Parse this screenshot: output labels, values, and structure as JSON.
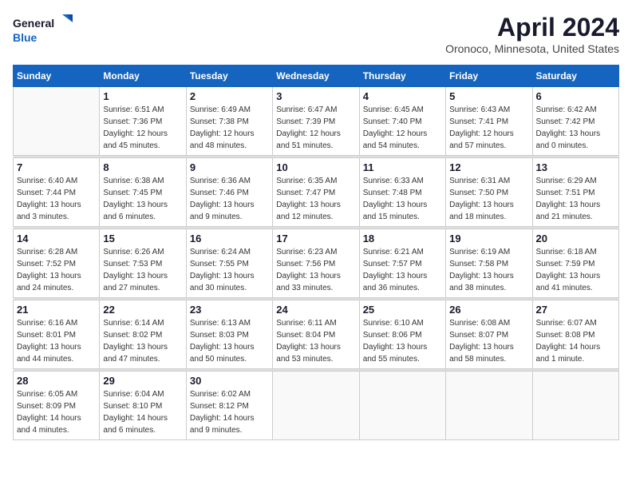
{
  "header": {
    "logo_line1": "General",
    "logo_line2": "Blue",
    "month_title": "April 2024",
    "subtitle": "Oronoco, Minnesota, United States"
  },
  "days_of_week": [
    "Sunday",
    "Monday",
    "Tuesday",
    "Wednesday",
    "Thursday",
    "Friday",
    "Saturday"
  ],
  "weeks": [
    [
      {
        "day": "",
        "info": ""
      },
      {
        "day": "1",
        "info": "Sunrise: 6:51 AM\nSunset: 7:36 PM\nDaylight: 12 hours\nand 45 minutes."
      },
      {
        "day": "2",
        "info": "Sunrise: 6:49 AM\nSunset: 7:38 PM\nDaylight: 12 hours\nand 48 minutes."
      },
      {
        "day": "3",
        "info": "Sunrise: 6:47 AM\nSunset: 7:39 PM\nDaylight: 12 hours\nand 51 minutes."
      },
      {
        "day": "4",
        "info": "Sunrise: 6:45 AM\nSunset: 7:40 PM\nDaylight: 12 hours\nand 54 minutes."
      },
      {
        "day": "5",
        "info": "Sunrise: 6:43 AM\nSunset: 7:41 PM\nDaylight: 12 hours\nand 57 minutes."
      },
      {
        "day": "6",
        "info": "Sunrise: 6:42 AM\nSunset: 7:42 PM\nDaylight: 13 hours\nand 0 minutes."
      }
    ],
    [
      {
        "day": "7",
        "info": "Sunrise: 6:40 AM\nSunset: 7:44 PM\nDaylight: 13 hours\nand 3 minutes."
      },
      {
        "day": "8",
        "info": "Sunrise: 6:38 AM\nSunset: 7:45 PM\nDaylight: 13 hours\nand 6 minutes."
      },
      {
        "day": "9",
        "info": "Sunrise: 6:36 AM\nSunset: 7:46 PM\nDaylight: 13 hours\nand 9 minutes."
      },
      {
        "day": "10",
        "info": "Sunrise: 6:35 AM\nSunset: 7:47 PM\nDaylight: 13 hours\nand 12 minutes."
      },
      {
        "day": "11",
        "info": "Sunrise: 6:33 AM\nSunset: 7:48 PM\nDaylight: 13 hours\nand 15 minutes."
      },
      {
        "day": "12",
        "info": "Sunrise: 6:31 AM\nSunset: 7:50 PM\nDaylight: 13 hours\nand 18 minutes."
      },
      {
        "day": "13",
        "info": "Sunrise: 6:29 AM\nSunset: 7:51 PM\nDaylight: 13 hours\nand 21 minutes."
      }
    ],
    [
      {
        "day": "14",
        "info": "Sunrise: 6:28 AM\nSunset: 7:52 PM\nDaylight: 13 hours\nand 24 minutes."
      },
      {
        "day": "15",
        "info": "Sunrise: 6:26 AM\nSunset: 7:53 PM\nDaylight: 13 hours\nand 27 minutes."
      },
      {
        "day": "16",
        "info": "Sunrise: 6:24 AM\nSunset: 7:55 PM\nDaylight: 13 hours\nand 30 minutes."
      },
      {
        "day": "17",
        "info": "Sunrise: 6:23 AM\nSunset: 7:56 PM\nDaylight: 13 hours\nand 33 minutes."
      },
      {
        "day": "18",
        "info": "Sunrise: 6:21 AM\nSunset: 7:57 PM\nDaylight: 13 hours\nand 36 minutes."
      },
      {
        "day": "19",
        "info": "Sunrise: 6:19 AM\nSunset: 7:58 PM\nDaylight: 13 hours\nand 38 minutes."
      },
      {
        "day": "20",
        "info": "Sunrise: 6:18 AM\nSunset: 7:59 PM\nDaylight: 13 hours\nand 41 minutes."
      }
    ],
    [
      {
        "day": "21",
        "info": "Sunrise: 6:16 AM\nSunset: 8:01 PM\nDaylight: 13 hours\nand 44 minutes."
      },
      {
        "day": "22",
        "info": "Sunrise: 6:14 AM\nSunset: 8:02 PM\nDaylight: 13 hours\nand 47 minutes."
      },
      {
        "day": "23",
        "info": "Sunrise: 6:13 AM\nSunset: 8:03 PM\nDaylight: 13 hours\nand 50 minutes."
      },
      {
        "day": "24",
        "info": "Sunrise: 6:11 AM\nSunset: 8:04 PM\nDaylight: 13 hours\nand 53 minutes."
      },
      {
        "day": "25",
        "info": "Sunrise: 6:10 AM\nSunset: 8:06 PM\nDaylight: 13 hours\nand 55 minutes."
      },
      {
        "day": "26",
        "info": "Sunrise: 6:08 AM\nSunset: 8:07 PM\nDaylight: 13 hours\nand 58 minutes."
      },
      {
        "day": "27",
        "info": "Sunrise: 6:07 AM\nSunset: 8:08 PM\nDaylight: 14 hours\nand 1 minute."
      }
    ],
    [
      {
        "day": "28",
        "info": "Sunrise: 6:05 AM\nSunset: 8:09 PM\nDaylight: 14 hours\nand 4 minutes."
      },
      {
        "day": "29",
        "info": "Sunrise: 6:04 AM\nSunset: 8:10 PM\nDaylight: 14 hours\nand 6 minutes."
      },
      {
        "day": "30",
        "info": "Sunrise: 6:02 AM\nSunset: 8:12 PM\nDaylight: 14 hours\nand 9 minutes."
      },
      {
        "day": "",
        "info": ""
      },
      {
        "day": "",
        "info": ""
      },
      {
        "day": "",
        "info": ""
      },
      {
        "day": "",
        "info": ""
      }
    ]
  ]
}
